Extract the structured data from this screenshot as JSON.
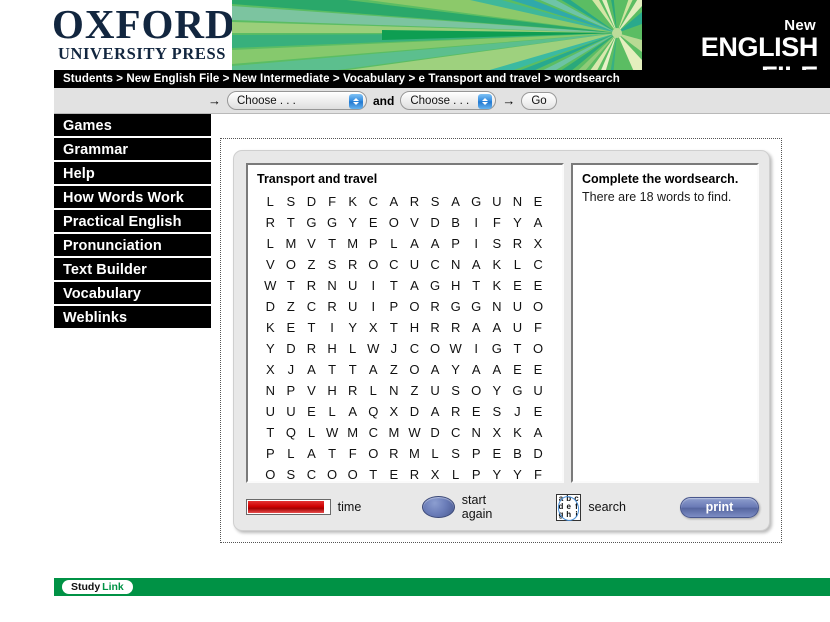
{
  "brand": {
    "oup_main": "OXFORD",
    "oup_sub": "UNIVERSITY PRESS",
    "nef_new": "New",
    "nef_main": "ENGLISH FILE"
  },
  "breadcrumb": {
    "text": "Students > New English File > New Intermediate > Vocabulary > e Transport and travel > wordsearch"
  },
  "chooser": {
    "arrow_left": "→",
    "select1_value": "Choose . . .",
    "and_label": "and",
    "select2_value": "Choose . . .",
    "arrow_right": "→",
    "go_label": "Go"
  },
  "sidebar": {
    "items": [
      {
        "label": "Games"
      },
      {
        "label": "Grammar"
      },
      {
        "label": "Help"
      },
      {
        "label": "How Words Work"
      },
      {
        "label": "Practical English"
      },
      {
        "label": "Pronunciation"
      },
      {
        "label": "Text Builder"
      },
      {
        "label": "Vocabulary"
      },
      {
        "label": "Weblinks"
      }
    ]
  },
  "activity": {
    "grid_title": "Transport and travel",
    "instruction_title": "Complete the wordsearch.",
    "instruction_sub": "There are 18 words to find.",
    "words_to_find": 18,
    "grid_rows": 14,
    "grid_cols": 14,
    "grid": [
      [
        "L",
        "S",
        "D",
        "F",
        "K",
        "C",
        "A",
        "R",
        "S",
        "A",
        "G",
        "U",
        "N",
        "E"
      ],
      [
        "R",
        "T",
        "G",
        "G",
        "Y",
        "E",
        "O",
        "V",
        "D",
        "B",
        "I",
        "F",
        "Y",
        "A"
      ],
      [
        "L",
        "M",
        "V",
        "T",
        "M",
        "P",
        "L",
        "A",
        "A",
        "P",
        "I",
        "S",
        "R",
        "X"
      ],
      [
        "V",
        "O",
        "Z",
        "S",
        "R",
        "O",
        "C",
        "U",
        "C",
        "N",
        "A",
        "K",
        "L",
        "C"
      ],
      [
        "W",
        "T",
        "R",
        "N",
        "U",
        "I",
        "T",
        "A",
        "G",
        "H",
        "T",
        "K",
        "E",
        "E"
      ],
      [
        "D",
        "Z",
        "C",
        "R",
        "U",
        "I",
        "P",
        "O",
        "R",
        "G",
        "G",
        "N",
        "U",
        "O"
      ],
      [
        "K",
        "E",
        "T",
        "I",
        "Y",
        "X",
        "T",
        "H",
        "R",
        "R",
        "A",
        "A",
        "U",
        "F"
      ],
      [
        "Y",
        "D",
        "R",
        "H",
        "L",
        "W",
        "J",
        "C",
        "O",
        "W",
        "I",
        "G",
        "T",
        "O"
      ],
      [
        "X",
        "J",
        "A",
        "T",
        "T",
        "A",
        "Z",
        "O",
        "A",
        "Y",
        "A",
        "A",
        "E",
        "E"
      ],
      [
        "N",
        "P",
        "V",
        "H",
        "R",
        "L",
        "N",
        "Z",
        "U",
        "S",
        "O",
        "Y",
        "G",
        "U"
      ],
      [
        "U",
        "U",
        "E",
        "L",
        "A",
        "Q",
        "X",
        "D",
        "A",
        "R",
        "E",
        "S",
        "J",
        "E"
      ],
      [
        "T",
        "Q",
        "L",
        "W",
        "M",
        "C",
        "M",
        "W",
        "D",
        "C",
        "N",
        "X",
        "K",
        "A"
      ],
      [
        "P",
        "L",
        "A",
        "T",
        "F",
        "O",
        "R",
        "M",
        "L",
        "S",
        "P",
        "E",
        "B",
        "D"
      ],
      [
        "O",
        "S",
        "C",
        "O",
        "O",
        "T",
        "E",
        "R",
        "X",
        "L",
        "P",
        "Y",
        "Y",
        "F"
      ]
    ]
  },
  "toolbar": {
    "time_label": "time",
    "time_progress_percent": 94,
    "start_again_label": "start again",
    "search_label": "search",
    "search_icon_letters": [
      "a",
      "b",
      "c",
      "d",
      "e",
      "f",
      "g",
      "h",
      "i"
    ],
    "print_label": "print"
  },
  "footer": {
    "studylink_first": "Study",
    "studylink_second": "Link"
  },
  "colors": {
    "breadcrumb_bg": "#000000",
    "banner_green": "#57b85c",
    "footer_green": "#009245",
    "time_red": "#d00000",
    "button_blue": "#6878b4",
    "chooser_bg": "#e2e2e2"
  }
}
